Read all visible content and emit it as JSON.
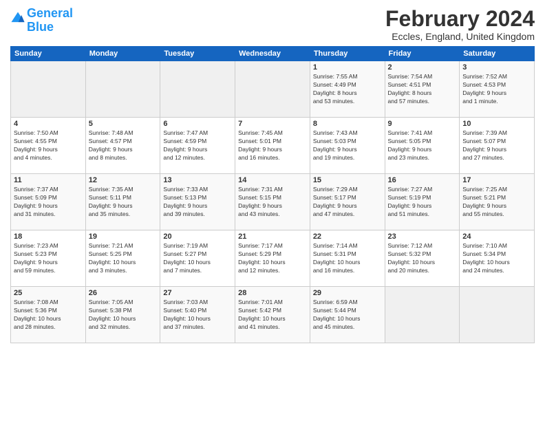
{
  "logo": {
    "text_general": "General",
    "text_blue": "Blue"
  },
  "header": {
    "title": "February 2024",
    "subtitle": "Eccles, England, United Kingdom"
  },
  "days_of_week": [
    "Sunday",
    "Monday",
    "Tuesday",
    "Wednesday",
    "Thursday",
    "Friday",
    "Saturday"
  ],
  "weeks": [
    [
      {
        "day": "",
        "info": ""
      },
      {
        "day": "",
        "info": ""
      },
      {
        "day": "",
        "info": ""
      },
      {
        "day": "",
        "info": ""
      },
      {
        "day": "1",
        "info": "Sunrise: 7:55 AM\nSunset: 4:49 PM\nDaylight: 8 hours\nand 53 minutes."
      },
      {
        "day": "2",
        "info": "Sunrise: 7:54 AM\nSunset: 4:51 PM\nDaylight: 8 hours\nand 57 minutes."
      },
      {
        "day": "3",
        "info": "Sunrise: 7:52 AM\nSunset: 4:53 PM\nDaylight: 9 hours\nand 1 minute."
      }
    ],
    [
      {
        "day": "4",
        "info": "Sunrise: 7:50 AM\nSunset: 4:55 PM\nDaylight: 9 hours\nand 4 minutes."
      },
      {
        "day": "5",
        "info": "Sunrise: 7:48 AM\nSunset: 4:57 PM\nDaylight: 9 hours\nand 8 minutes."
      },
      {
        "day": "6",
        "info": "Sunrise: 7:47 AM\nSunset: 4:59 PM\nDaylight: 9 hours\nand 12 minutes."
      },
      {
        "day": "7",
        "info": "Sunrise: 7:45 AM\nSunset: 5:01 PM\nDaylight: 9 hours\nand 16 minutes."
      },
      {
        "day": "8",
        "info": "Sunrise: 7:43 AM\nSunset: 5:03 PM\nDaylight: 9 hours\nand 19 minutes."
      },
      {
        "day": "9",
        "info": "Sunrise: 7:41 AM\nSunset: 5:05 PM\nDaylight: 9 hours\nand 23 minutes."
      },
      {
        "day": "10",
        "info": "Sunrise: 7:39 AM\nSunset: 5:07 PM\nDaylight: 9 hours\nand 27 minutes."
      }
    ],
    [
      {
        "day": "11",
        "info": "Sunrise: 7:37 AM\nSunset: 5:09 PM\nDaylight: 9 hours\nand 31 minutes."
      },
      {
        "day": "12",
        "info": "Sunrise: 7:35 AM\nSunset: 5:11 PM\nDaylight: 9 hours\nand 35 minutes."
      },
      {
        "day": "13",
        "info": "Sunrise: 7:33 AM\nSunset: 5:13 PM\nDaylight: 9 hours\nand 39 minutes."
      },
      {
        "day": "14",
        "info": "Sunrise: 7:31 AM\nSunset: 5:15 PM\nDaylight: 9 hours\nand 43 minutes."
      },
      {
        "day": "15",
        "info": "Sunrise: 7:29 AM\nSunset: 5:17 PM\nDaylight: 9 hours\nand 47 minutes."
      },
      {
        "day": "16",
        "info": "Sunrise: 7:27 AM\nSunset: 5:19 PM\nDaylight: 9 hours\nand 51 minutes."
      },
      {
        "day": "17",
        "info": "Sunrise: 7:25 AM\nSunset: 5:21 PM\nDaylight: 9 hours\nand 55 minutes."
      }
    ],
    [
      {
        "day": "18",
        "info": "Sunrise: 7:23 AM\nSunset: 5:23 PM\nDaylight: 9 hours\nand 59 minutes."
      },
      {
        "day": "19",
        "info": "Sunrise: 7:21 AM\nSunset: 5:25 PM\nDaylight: 10 hours\nand 3 minutes."
      },
      {
        "day": "20",
        "info": "Sunrise: 7:19 AM\nSunset: 5:27 PM\nDaylight: 10 hours\nand 7 minutes."
      },
      {
        "day": "21",
        "info": "Sunrise: 7:17 AM\nSunset: 5:29 PM\nDaylight: 10 hours\nand 12 minutes."
      },
      {
        "day": "22",
        "info": "Sunrise: 7:14 AM\nSunset: 5:31 PM\nDaylight: 10 hours\nand 16 minutes."
      },
      {
        "day": "23",
        "info": "Sunrise: 7:12 AM\nSunset: 5:32 PM\nDaylight: 10 hours\nand 20 minutes."
      },
      {
        "day": "24",
        "info": "Sunrise: 7:10 AM\nSunset: 5:34 PM\nDaylight: 10 hours\nand 24 minutes."
      }
    ],
    [
      {
        "day": "25",
        "info": "Sunrise: 7:08 AM\nSunset: 5:36 PM\nDaylight: 10 hours\nand 28 minutes."
      },
      {
        "day": "26",
        "info": "Sunrise: 7:05 AM\nSunset: 5:38 PM\nDaylight: 10 hours\nand 32 minutes."
      },
      {
        "day": "27",
        "info": "Sunrise: 7:03 AM\nSunset: 5:40 PM\nDaylight: 10 hours\nand 37 minutes."
      },
      {
        "day": "28",
        "info": "Sunrise: 7:01 AM\nSunset: 5:42 PM\nDaylight: 10 hours\nand 41 minutes."
      },
      {
        "day": "29",
        "info": "Sunrise: 6:59 AM\nSunset: 5:44 PM\nDaylight: 10 hours\nand 45 minutes."
      },
      {
        "day": "",
        "info": ""
      },
      {
        "day": "",
        "info": ""
      }
    ]
  ]
}
